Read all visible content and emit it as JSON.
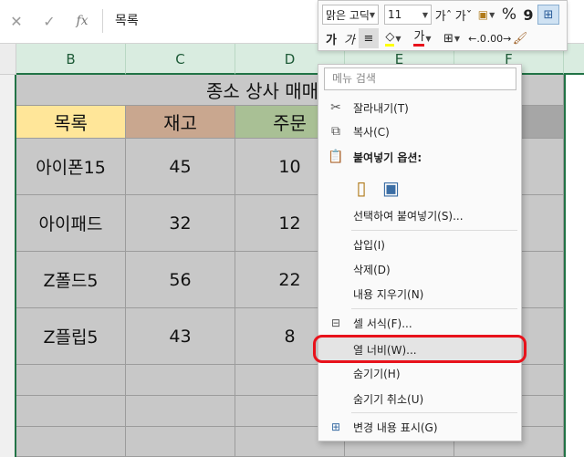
{
  "formula_bar": {
    "cancel_icon": "✕",
    "enter_icon": "✓",
    "fx_label": "fx",
    "value": "목록"
  },
  "columns": [
    "B",
    "C",
    "D",
    "E",
    "F"
  ],
  "sheet": {
    "title": "종소 상사 매매",
    "headers": [
      "목록",
      "재고",
      "주문"
    ],
    "header_colors": [
      "#ffe699",
      "#c9a78f",
      "#a9c095"
    ],
    "rows": [
      [
        "아이폰15",
        "45",
        "10"
      ],
      [
        "아이패드",
        "32",
        "12"
      ],
      [
        "Z폴드5",
        "56",
        "22"
      ],
      [
        "Z플립5",
        "43",
        "8"
      ]
    ]
  },
  "mini_toolbar": {
    "font_name": "맑은 고딕",
    "font_size": "11",
    "grow_font": "가ˆ",
    "shrink_font": "가ˇ",
    "percent": "%",
    "comma": "9",
    "bold": "가",
    "italic": "가",
    "font_color_letter": "가"
  },
  "context_menu": {
    "search_placeholder": "메뉴 검색",
    "items": {
      "cut": "잘라내기(T)",
      "copy": "복사(C)",
      "paste_options": "붙여넣기 옵션:",
      "paste_special": "선택하여 붙여넣기(S)...",
      "insert": "삽입(I)",
      "delete": "삭제(D)",
      "clear": "내용 지우기(N)",
      "format_cells": "셀 서식(F)...",
      "column_width": "열 너비(W)...",
      "hide": "숨기기(H)",
      "unhide": "숨기기 취소(U)",
      "show_changes": "변경 내용 표시(G)"
    }
  },
  "colors": {
    "excel_green": "#217346",
    "highlight_red": "#e8121b",
    "grid_fill": "#c8c8c8"
  }
}
